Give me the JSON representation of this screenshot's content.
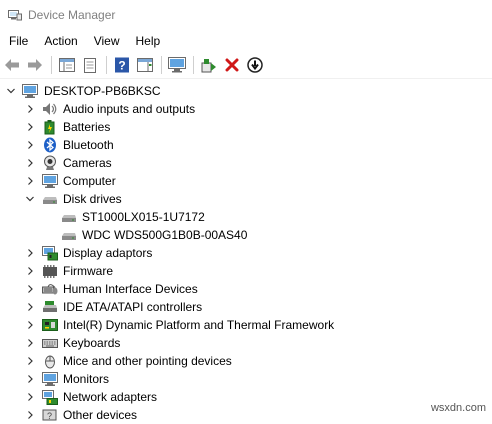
{
  "window": {
    "title": "Device Manager"
  },
  "menu": [
    "File",
    "Action",
    "View",
    "Help"
  ],
  "toolbar": {
    "buttons": [
      {
        "name": "back-icon"
      },
      {
        "name": "forward-icon"
      },
      {
        "name": "show-hide-tree-icon"
      },
      {
        "name": "properties-icon"
      },
      {
        "name": "help-icon"
      },
      {
        "name": "action-pane-icon"
      },
      {
        "name": "scan-hardware-icon"
      },
      {
        "name": "update-driver-icon"
      },
      {
        "name": "uninstall-icon"
      },
      {
        "name": "disable-icon"
      }
    ]
  },
  "tree": {
    "root": {
      "label": "DESKTOP-PB6BKSC",
      "expanded": true
    },
    "items": [
      {
        "label": "Audio inputs and outputs",
        "icon": "speaker-icon",
        "expanded": false
      },
      {
        "label": "Batteries",
        "icon": "battery-icon",
        "expanded": false
      },
      {
        "label": "Bluetooth",
        "icon": "bluetooth-icon",
        "expanded": false
      },
      {
        "label": "Cameras",
        "icon": "camera-icon",
        "expanded": false
      },
      {
        "label": "Computer",
        "icon": "monitor-icon",
        "expanded": false
      },
      {
        "label": "Disk drives",
        "icon": "disk-drive-icon",
        "expanded": true,
        "children": [
          {
            "label": "ST1000LX015-1U7172",
            "icon": "disk-drive-icon"
          },
          {
            "label": "WDC WDS500G1B0B-00AS40",
            "icon": "disk-drive-icon"
          }
        ]
      },
      {
        "label": "Display adaptors",
        "icon": "display-adapter-icon",
        "expanded": false
      },
      {
        "label": "Firmware",
        "icon": "firmware-icon",
        "expanded": false
      },
      {
        "label": "Human Interface Devices",
        "icon": "hid-icon",
        "expanded": false
      },
      {
        "label": "IDE ATA/ATAPI controllers",
        "icon": "ide-controller-icon",
        "expanded": false
      },
      {
        "label": "Intel(R) Dynamic Platform and Thermal Framework",
        "icon": "chip-icon",
        "expanded": false
      },
      {
        "label": "Keyboards",
        "icon": "keyboard-icon",
        "expanded": false
      },
      {
        "label": "Mice and other pointing devices",
        "icon": "mouse-icon",
        "expanded": false
      },
      {
        "label": "Monitors",
        "icon": "monitor-icon",
        "expanded": false
      },
      {
        "label": "Network adapters",
        "icon": "network-adapter-icon",
        "expanded": false
      },
      {
        "label": "Other devices",
        "icon": "unknown-device-icon",
        "expanded": false
      }
    ]
  },
  "watermark": "wsxdn.com"
}
